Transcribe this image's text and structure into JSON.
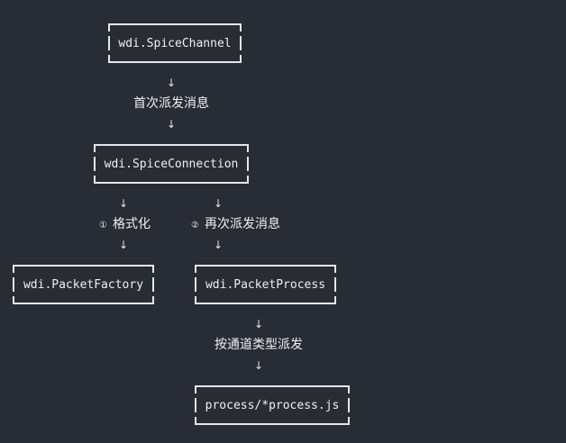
{
  "nodes": {
    "spice_channel": "wdi.SpiceChannel",
    "spice_connection": "wdi.SpiceConnection",
    "packet_factory": "wdi.PacketFactory",
    "packet_process": "wdi.PacketProcess",
    "process_js": "process/*process.js"
  },
  "edges": {
    "first_dispatch": "首次派发消息",
    "format_num": "①",
    "format": "格式化",
    "redispatch_num": "②",
    "redispatch": "再次派发消息",
    "by_channel_type": "按通道类型派发"
  },
  "arrow_glyph": "↓"
}
